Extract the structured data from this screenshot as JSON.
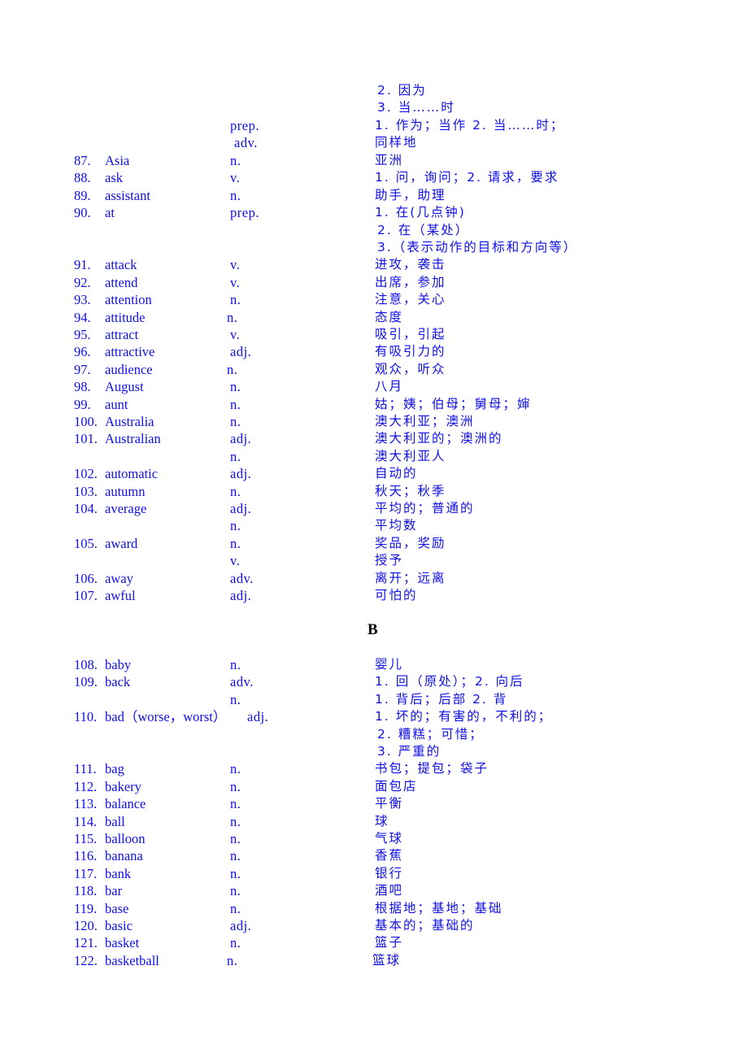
{
  "document": {
    "text_color": "#1010e8",
    "section_heading": "B",
    "continuation": [
      {
        "pos": "",
        "def": "2. 因为"
      },
      {
        "pos": "",
        "def": "3. 当……时"
      },
      {
        "pos": "prep.",
        "def": "1. 作为；当作   2. 当……时；"
      },
      {
        "pos": "adv.",
        "def": "同样地"
      }
    ],
    "entries_a": [
      {
        "num": "87.",
        "word": "Asia",
        "pos": "n.",
        "def": "亚洲"
      },
      {
        "num": "88.",
        "word": "ask",
        "pos": "v.",
        "def": "1. 问，询问；2. 请求，要求"
      },
      {
        "num": "89.",
        "word": "assistant",
        "pos": "n.",
        "def": "助手，助理"
      },
      {
        "num": "90.",
        "word": "at",
        "pos": "prep.",
        "def": "1. 在(几点钟)"
      },
      {
        "num": "",
        "word": "",
        "pos": "",
        "def": "2. 在（某处）"
      },
      {
        "num": "",
        "word": "",
        "pos": "",
        "def": "3.（表示动作的目标和方向等）"
      },
      {
        "num": "91.",
        "word": "attack",
        "pos": "v.",
        "def": "进攻，袭击"
      },
      {
        "num": "92.",
        "word": "attend",
        "pos": "v.",
        "def": "出席，参加"
      },
      {
        "num": "93.",
        "word": "attention",
        "pos": "n.",
        "def": "注意，关心"
      },
      {
        "num": "94.",
        "word": "attitude",
        "pos": "n.",
        "def": "态度"
      },
      {
        "num": "95.",
        "word": "attract",
        "pos": "v.",
        "def": "吸引，引起"
      },
      {
        "num": "96.",
        "word": "attractive",
        "pos": "adj.",
        "def": "有吸引力的"
      },
      {
        "num": "97.",
        "word": "audience",
        "pos": "n.",
        "def": "观众，听众"
      },
      {
        "num": "98.",
        "word": "August",
        "pos": "n.",
        "def": "八月"
      },
      {
        "num": "99.",
        "word": "aunt",
        "pos": "n.",
        "def": "姑；姨；伯母；舅母；婶"
      },
      {
        "num": "100.",
        "word": "Australia",
        "pos": "n.",
        "def": "澳大利亚；澳洲"
      },
      {
        "num": "101.",
        "word": "Australian",
        "pos": "adj.",
        "def": "澳大利亚的；澳洲的"
      },
      {
        "num": "",
        "word": "",
        "pos": "n.",
        "def": "澳大利亚人"
      },
      {
        "num": "102.",
        "word": "automatic",
        "pos": "adj.",
        "def": "自动的"
      },
      {
        "num": "103.",
        "word": "autumn",
        "pos": "n.",
        "def": "秋天；秋季"
      },
      {
        "num": "104.",
        "word": "average",
        "pos": "adj.",
        "def": "平均的；普通的"
      },
      {
        "num": "",
        "word": "",
        "pos": "n.",
        "def": "平均数"
      },
      {
        "num": "105.",
        "word": "award",
        "pos": "n.",
        "def": "奖品，奖励"
      },
      {
        "num": "",
        "word": "",
        "pos": "v.",
        "def": "授予"
      },
      {
        "num": "106.",
        "word": "away",
        "pos": "adv.",
        "def": "离开；远离"
      },
      {
        "num": "107.",
        "word": "awful",
        "pos": "adj.",
        "def": "可怕的"
      }
    ],
    "entries_b": [
      {
        "num": "108.",
        "word": "baby",
        "pos": "n.",
        "def": "婴儿"
      },
      {
        "num": "109.",
        "word": "back",
        "pos": "adv.",
        "def": "1. 回（原处）；2. 向后"
      },
      {
        "num": "",
        "word": "",
        "pos": "n.",
        "def": "1. 背后；后部 2. 背"
      },
      {
        "num": "110.",
        "word": "bad（worse，worst）",
        "pos": "adj.",
        "def": "1. 坏的；有害的，不利的；"
      },
      {
        "num": "",
        "word": "",
        "pos": "",
        "def": "2. 糟糕；可惜；"
      },
      {
        "num": "",
        "word": "",
        "pos": "",
        "def": "3. 严重的"
      },
      {
        "num": "111.",
        "word": "bag",
        "pos": "n.",
        "def": "书包；提包；袋子"
      },
      {
        "num": "112.",
        "word": "bakery",
        "pos": "n.",
        "def": "面包店"
      },
      {
        "num": "113.",
        "word": "balance",
        "pos": "n.",
        "def": "平衡"
      },
      {
        "num": "114.",
        "word": "ball",
        "pos": "n.",
        "def": "球"
      },
      {
        "num": "115.",
        "word": "balloon",
        "pos": "n.",
        "def": "气球"
      },
      {
        "num": "116.",
        "word": "banana",
        "pos": "n.",
        "def": "香蕉"
      },
      {
        "num": "117.",
        "word": "bank",
        "pos": "n.",
        "def": "银行"
      },
      {
        "num": "118.",
        "word": "bar",
        "pos": "n.",
        "def": "酒吧"
      },
      {
        "num": "119.",
        "word": "base",
        "pos": "n.",
        "def": "根据地；基地；基础"
      },
      {
        "num": "120.",
        "word": "basic",
        "pos": "adj.",
        "def": "基本的；基础的"
      },
      {
        "num": "121.",
        "word": "basket",
        "pos": "n.",
        "def": "篮子"
      },
      {
        "num": "122.",
        "word": "basketball",
        "pos": "n.",
        "def": "篮球"
      }
    ]
  }
}
